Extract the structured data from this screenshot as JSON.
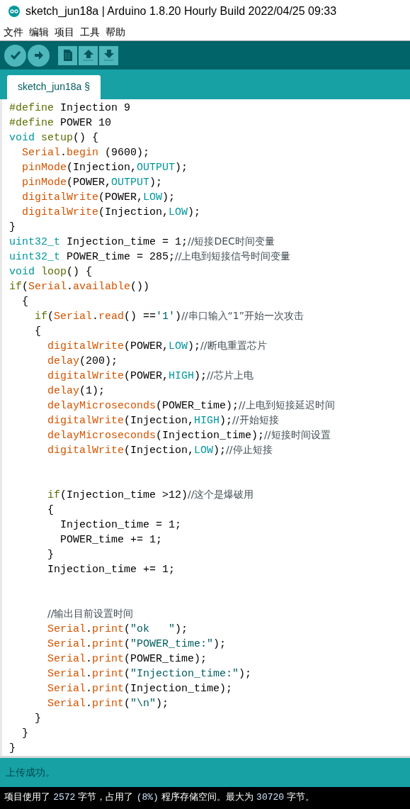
{
  "window": {
    "title": "sketch_jun18a | Arduino 1.8.20 Hourly Build 2022/04/25 09:33"
  },
  "menu": [
    "文件",
    "编辑",
    "项目",
    "工具",
    "帮助"
  ],
  "toolbar": [
    {
      "kind": "verify"
    },
    {
      "kind": "upload"
    },
    {
      "kind": "new"
    },
    {
      "kind": "open"
    },
    {
      "kind": "save"
    }
  ],
  "tabs": [
    {
      "label": "sketch_jun18a §",
      "selected": true
    }
  ],
  "code": [
    [
      {
        "kind": "directive",
        "text": "#define"
      },
      {
        "kind": "plain",
        "text": " Injection 9"
      }
    ],
    [
      {
        "kind": "directive",
        "text": "#define"
      },
      {
        "kind": "plain",
        "text": " POWER 10"
      }
    ],
    [
      {
        "kind": "type",
        "text": "void"
      },
      {
        "kind": "directive",
        "text": " setup"
      },
      {
        "kind": "plain",
        "text": "() {"
      }
    ],
    [
      {
        "kind": "function",
        "text": "  Serial"
      },
      {
        "kind": "plain",
        "text": "."
      },
      {
        "kind": "function",
        "text": "begin"
      },
      {
        "kind": "plain",
        "text": " (9600);"
      }
    ],
    [
      {
        "kind": "function",
        "text": "  pinMode"
      },
      {
        "kind": "plain",
        "text": "(Injection,"
      },
      {
        "kind": "constant",
        "text": "OUTPUT"
      },
      {
        "kind": "plain",
        "text": ");"
      }
    ],
    [
      {
        "kind": "function",
        "text": "  pinMode"
      },
      {
        "kind": "plain",
        "text": "(POWER,"
      },
      {
        "kind": "constant",
        "text": "OUTPUT"
      },
      {
        "kind": "plain",
        "text": ");"
      }
    ],
    [
      {
        "kind": "function",
        "text": "  digitalWrite"
      },
      {
        "kind": "plain",
        "text": "(POWER,"
      },
      {
        "kind": "constant",
        "text": "LOW"
      },
      {
        "kind": "plain",
        "text": ");"
      }
    ],
    [
      {
        "kind": "function",
        "text": "  digitalWrite"
      },
      {
        "kind": "plain",
        "text": "(Injection,"
      },
      {
        "kind": "constant",
        "text": "LOW"
      },
      {
        "kind": "plain",
        "text": ");"
      }
    ],
    [
      {
        "kind": "plain",
        "text": "}"
      }
    ],
    [
      {
        "kind": "type",
        "text": "uint32_t"
      },
      {
        "kind": "plain",
        "text": " Injection_time = 1;"
      },
      {
        "kind": "comment",
        "text": "//短接DEC时间变量"
      }
    ],
    [
      {
        "kind": "type",
        "text": "uint32_t"
      },
      {
        "kind": "plain",
        "text": " POWER_time = 285;"
      },
      {
        "kind": "comment",
        "text": "//上电到短接信号时间变量"
      }
    ],
    [
      {
        "kind": "type",
        "text": "void"
      },
      {
        "kind": "directive",
        "text": " loop"
      },
      {
        "kind": "plain",
        "text": "() {"
      }
    ],
    [
      {
        "kind": "directive",
        "text": "if"
      },
      {
        "kind": "plain",
        "text": "("
      },
      {
        "kind": "function",
        "text": "Serial"
      },
      {
        "kind": "plain",
        "text": "."
      },
      {
        "kind": "function",
        "text": "available"
      },
      {
        "kind": "plain",
        "text": "())"
      }
    ],
    [
      {
        "kind": "plain",
        "text": "  {"
      }
    ],
    [
      {
        "kind": "directive",
        "text": "    if"
      },
      {
        "kind": "plain",
        "text": "("
      },
      {
        "kind": "function",
        "text": "Serial"
      },
      {
        "kind": "plain",
        "text": "."
      },
      {
        "kind": "function",
        "text": "read"
      },
      {
        "kind": "plain",
        "text": "() =="
      },
      {
        "kind": "string",
        "text": "'1'"
      },
      {
        "kind": "plain",
        "text": ")"
      },
      {
        "kind": "comment",
        "text": "//串口输入“1”开始一次攻击"
      }
    ],
    [
      {
        "kind": "plain",
        "text": "    {"
      }
    ],
    [
      {
        "kind": "function",
        "text": "      digitalWrite"
      },
      {
        "kind": "plain",
        "text": "(POWER,"
      },
      {
        "kind": "constant",
        "text": "LOW"
      },
      {
        "kind": "plain",
        "text": ");"
      },
      {
        "kind": "comment",
        "text": "//断电重置芯片"
      }
    ],
    [
      {
        "kind": "function",
        "text": "      delay"
      },
      {
        "kind": "plain",
        "text": "(200);"
      }
    ],
    [
      {
        "kind": "function",
        "text": "      digitalWrite"
      },
      {
        "kind": "plain",
        "text": "(POWER,"
      },
      {
        "kind": "constant",
        "text": "HIGH"
      },
      {
        "kind": "plain",
        "text": ");"
      },
      {
        "kind": "comment",
        "text": "//芯片上电"
      }
    ],
    [
      {
        "kind": "function",
        "text": "      delay"
      },
      {
        "kind": "plain",
        "text": "(1);"
      }
    ],
    [
      {
        "kind": "function",
        "text": "      delayMicroseconds"
      },
      {
        "kind": "plain",
        "text": "(POWER_time);"
      },
      {
        "kind": "comment",
        "text": "//上电到短接延迟时间"
      }
    ],
    [
      {
        "kind": "function",
        "text": "      digitalWrite"
      },
      {
        "kind": "plain",
        "text": "(Injection,"
      },
      {
        "kind": "constant",
        "text": "HIGH"
      },
      {
        "kind": "plain",
        "text": ");"
      },
      {
        "kind": "comment",
        "text": "//开始短接"
      }
    ],
    [
      {
        "kind": "function",
        "text": "      delayMicroseconds"
      },
      {
        "kind": "plain",
        "text": "(Injection_time);"
      },
      {
        "kind": "comment",
        "text": "//短接时间设置"
      }
    ],
    [
      {
        "kind": "function",
        "text": "      digitalWrite"
      },
      {
        "kind": "plain",
        "text": "(Injection,"
      },
      {
        "kind": "constant",
        "text": "LOW"
      },
      {
        "kind": "plain",
        "text": ");"
      },
      {
        "kind": "comment",
        "text": "//停止短接"
      }
    ],
    [
      {
        "kind": "blank"
      }
    ],
    [
      {
        "kind": "blank"
      }
    ],
    [
      {
        "kind": "directive",
        "text": "      if"
      },
      {
        "kind": "plain",
        "text": "(Injection_time >12)"
      },
      {
        "kind": "comment",
        "text": "//这个是爆破用"
      }
    ],
    [
      {
        "kind": "plain",
        "text": "      {"
      }
    ],
    [
      {
        "kind": "plain",
        "text": "        Injection_time = 1;"
      }
    ],
    [
      {
        "kind": "plain",
        "text": "        POWER_time += 1;"
      }
    ],
    [
      {
        "kind": "plain",
        "text": "      }"
      }
    ],
    [
      {
        "kind": "plain",
        "text": "      Injection_time += 1;"
      }
    ],
    [
      {
        "kind": "blank"
      }
    ],
    [
      {
        "kind": "blank"
      }
    ],
    [
      {
        "kind": "comment",
        "text": "      //输出目前设置时间"
      }
    ],
    [
      {
        "kind": "function",
        "text": "      Serial"
      },
      {
        "kind": "plain",
        "text": "."
      },
      {
        "kind": "function",
        "text": "print"
      },
      {
        "kind": "plain",
        "text": "("
      },
      {
        "kind": "string",
        "text": "\"ok   \""
      },
      {
        "kind": "plain",
        "text": ");"
      }
    ],
    [
      {
        "kind": "function",
        "text": "      Serial"
      },
      {
        "kind": "plain",
        "text": "."
      },
      {
        "kind": "function",
        "text": "print"
      },
      {
        "kind": "plain",
        "text": "("
      },
      {
        "kind": "string",
        "text": "\"POWER_time:\""
      },
      {
        "kind": "plain",
        "text": ");"
      }
    ],
    [
      {
        "kind": "function",
        "text": "      Serial"
      },
      {
        "kind": "plain",
        "text": "."
      },
      {
        "kind": "function",
        "text": "print"
      },
      {
        "kind": "plain",
        "text": "(POWER_time);"
      }
    ],
    [
      {
        "kind": "function",
        "text": "      Serial"
      },
      {
        "kind": "plain",
        "text": "."
      },
      {
        "kind": "function",
        "text": "print"
      },
      {
        "kind": "plain",
        "text": "("
      },
      {
        "kind": "string",
        "text": "\"Injection_time:\""
      },
      {
        "kind": "plain",
        "text": ");"
      }
    ],
    [
      {
        "kind": "function",
        "text": "      Serial"
      },
      {
        "kind": "plain",
        "text": "."
      },
      {
        "kind": "function",
        "text": "print"
      },
      {
        "kind": "plain",
        "text": "(Injection_time);"
      }
    ],
    [
      {
        "kind": "function",
        "text": "      Serial"
      },
      {
        "kind": "plain",
        "text": "."
      },
      {
        "kind": "function",
        "text": "print"
      },
      {
        "kind": "plain",
        "text": "("
      },
      {
        "kind": "string",
        "text": "\"\\n\""
      },
      {
        "kind": "plain",
        "text": ");"
      }
    ],
    [
      {
        "kind": "plain",
        "text": "    }"
      }
    ],
    [
      {
        "kind": "plain",
        "text": "  }"
      }
    ],
    [
      {
        "kind": "plain",
        "text": "}"
      }
    ]
  ],
  "status": "上传成功。",
  "console": [
    {
      "kind": "text",
      "text": "项目使用了 "
    },
    {
      "kind": "number",
      "text": "2572"
    },
    {
      "kind": "text",
      "text": " 字节，占用了 "
    },
    {
      "kind": "number",
      "text": "(8%)"
    },
    {
      "kind": "text",
      "text": " 程序存储空间。最大为 "
    },
    {
      "kind": "number",
      "text": "30720"
    },
    {
      "kind": "text",
      "text": " 字节。"
    }
  ]
}
